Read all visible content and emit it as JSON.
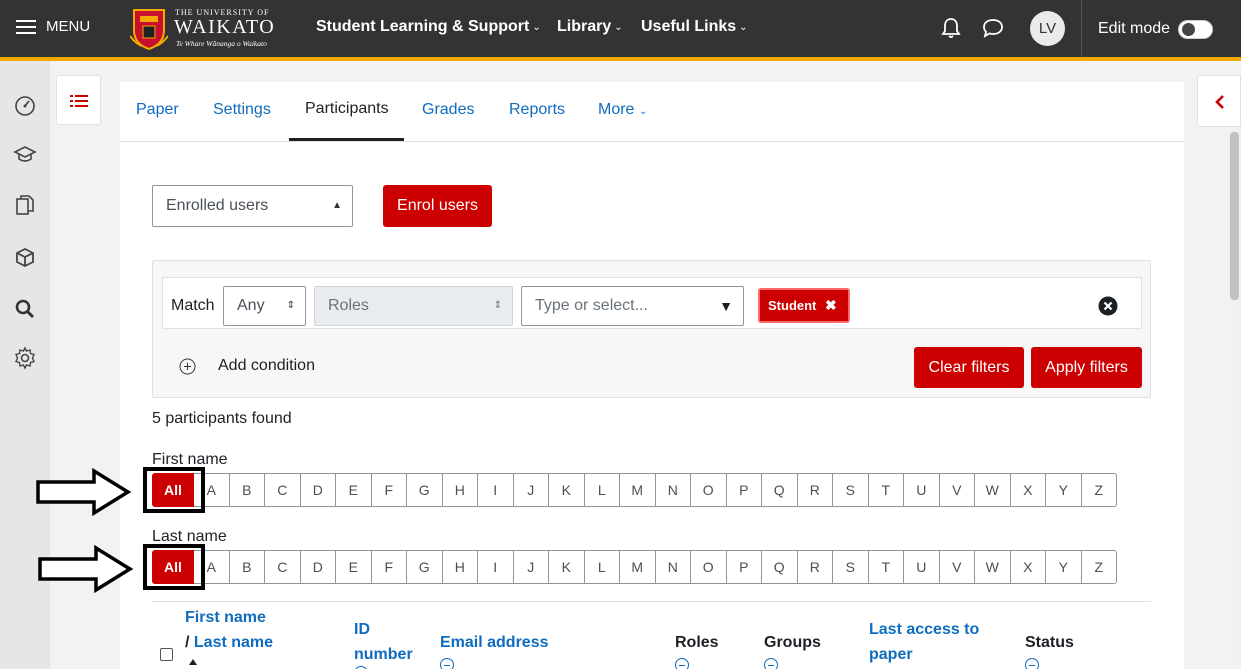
{
  "topbar": {
    "menu_label": "MENU",
    "logo": {
      "line1": "THE UNIVERSITY OF",
      "line2": "WAIKATO",
      "line3": "Te Whare Wānanga o Waikato"
    },
    "nav": [
      {
        "label": "Student Learning & Support"
      },
      {
        "label": "Library"
      },
      {
        "label": "Useful Links"
      }
    ],
    "user_initials": "LV",
    "edit_mode_label": "Edit mode",
    "edit_mode_on": false,
    "accent_color": "#f4a900"
  },
  "left_rail": {
    "icons": [
      "dashboard-icon",
      "graduation-cap-icon",
      "documents-icon",
      "cube-icon",
      "search-icon",
      "gear-icon"
    ]
  },
  "tabs": [
    {
      "label": "Paper"
    },
    {
      "label": "Settings"
    },
    {
      "label": "Participants",
      "active": true
    },
    {
      "label": "Grades"
    },
    {
      "label": "Reports"
    },
    {
      "label": "More"
    }
  ],
  "enrol": {
    "select_value": "Enrolled users",
    "button_label": "Enrol users"
  },
  "filter": {
    "match_label": "Match",
    "match_value": "Any",
    "type_value": "Roles",
    "value_placeholder": "Type or select...",
    "tag_label": "Student",
    "add_condition_label": "Add condition",
    "clear_label": "Clear filters",
    "apply_label": "Apply filters"
  },
  "results": {
    "found_text": "5 participants found"
  },
  "initials": {
    "first_name_label": "First name",
    "last_name_label": "Last name",
    "all_label": "All",
    "letters": [
      "A",
      "B",
      "C",
      "D",
      "E",
      "F",
      "G",
      "H",
      "I",
      "J",
      "K",
      "L",
      "M",
      "N",
      "O",
      "P",
      "Q",
      "R",
      "S",
      "T",
      "U",
      "V",
      "W",
      "X",
      "Y",
      "Z"
    ]
  },
  "table": {
    "headers": {
      "first_name": "First name",
      "slash": "/",
      "last_name": "Last name",
      "id_number_1": "ID",
      "id_number_2": "number",
      "email": "Email address",
      "roles": "Roles",
      "groups": "Groups",
      "last_access_1": "Last access to",
      "last_access_2": "paper",
      "status": "Status"
    }
  },
  "colors": {
    "primary": "#cc0000",
    "link": "#0f6cbf",
    "topbar": "#333333"
  }
}
